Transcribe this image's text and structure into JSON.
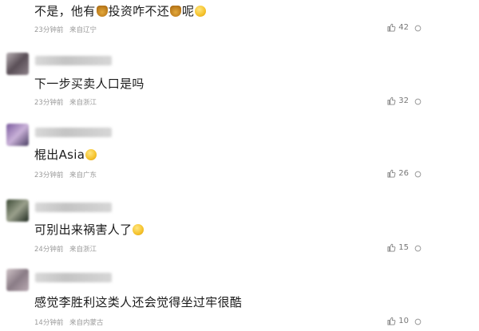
{
  "comments": [
    {
      "text_before": "不是，他有",
      "text_middle": "投资咋不还",
      "text_after": "呢",
      "time": "23分钟前",
      "location": "来自辽宁",
      "likes": "42",
      "emojis": [
        "money-bag-icon",
        "money-bag-icon",
        "smirk-face-icon"
      ]
    },
    {
      "text": "下一步买卖人口是吗",
      "time": "23分钟前",
      "location": "来自浙江",
      "likes": "32"
    },
    {
      "text": "棍出Asia",
      "time": "23分钟前",
      "location": "来自广东",
      "likes": "26",
      "emojis": [
        "grinning-sweat-icon"
      ]
    },
    {
      "text": "可别出来祸害人了",
      "time": "24分钟前",
      "location": "来自浙江",
      "likes": "15",
      "emojis": [
        "tired-face-icon"
      ]
    },
    {
      "text": "感觉李胜利这类人还会觉得坐过牢很酷",
      "time": "14分钟前",
      "location": "来自内蒙古",
      "likes": "10"
    }
  ]
}
